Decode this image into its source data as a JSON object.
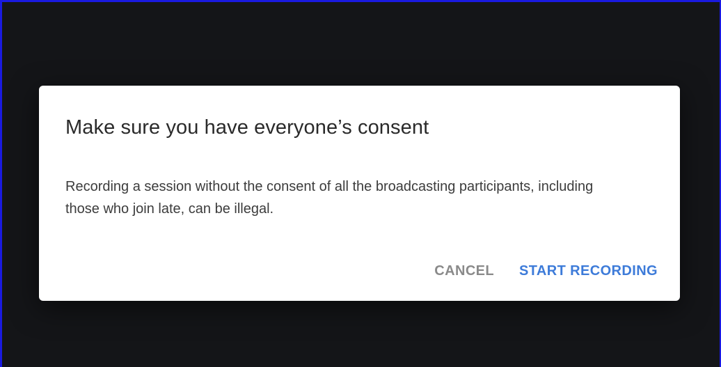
{
  "dialog": {
    "title": "Make sure you have everyone’s consent",
    "body": "Recording a session without the consent of all the broadcasting participants, including those who join late, can be illegal.",
    "actions": {
      "cancel_label": "CANCEL",
      "confirm_label": "START RECORDING"
    }
  },
  "colors": {
    "backdrop": "#141518",
    "dialog_background": "#ffffff",
    "accent": "#3d7bd9",
    "muted_button": "#8a8a8a",
    "window_border": "#1a1ae0"
  }
}
